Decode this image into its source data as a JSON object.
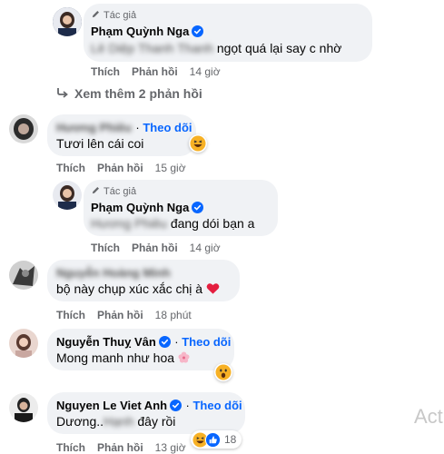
{
  "colors": {
    "accent": "#0866ff",
    "bubble": "#f0f2f5",
    "muted": "#65676b"
  },
  "comments": [
    {
      "id": "c1",
      "author": "Phạm Quỳnh Nga",
      "author_tag": "Tác giả",
      "text_mention": "Lê Diệp Thanh Thanh",
      "text": "ngọt quá lại say c nhờ",
      "like": "Thích",
      "reply": "Phản hồi",
      "time": "14 giờ"
    },
    {
      "id": "more",
      "label": "Xem thêm 2 phản hồi"
    },
    {
      "id": "c2",
      "author": "Hương Phiêu",
      "follow": "Theo dõi",
      "text": "Tươi lên cái coi",
      "reaction": "haha-icon",
      "like": "Thích",
      "reply": "Phản hồi",
      "time": "15 giờ"
    },
    {
      "id": "c3",
      "author": "Phạm Quỳnh Nga",
      "author_tag": "Tác giả",
      "text_mention": "Hương Phiêu",
      "text": "đang dói bạn a",
      "like": "Thích",
      "reply": "Phản hồi",
      "time": "14 giờ"
    },
    {
      "id": "c4",
      "author": "Nguyễn Hoàng Minh",
      "text": "bộ này chụp xúc xắc chị à",
      "text_emoji": "heart",
      "like": "Thích",
      "reply": "Phản hồi",
      "time": "18 phút"
    },
    {
      "id": "c5",
      "author": "Nguyễn Thuỵ Vân",
      "follow": "Theo dõi",
      "text": "Mong manh như hoa",
      "reaction": "wow-icon",
      "like": "Thích",
      "reply": "Phản hồi",
      "time": "14 giờ"
    },
    {
      "id": "c6",
      "author": "Nguyen Le Viet Anh",
      "follow": "Theo dõi",
      "text_start": "Dương..",
      "text_hidden": "Hạnh",
      "text_end": "đây rồi",
      "reaction_count": "18",
      "like": "Thích",
      "reply": "Phản hồi",
      "time": "13 giờ"
    }
  ],
  "watermark": "Acti"
}
